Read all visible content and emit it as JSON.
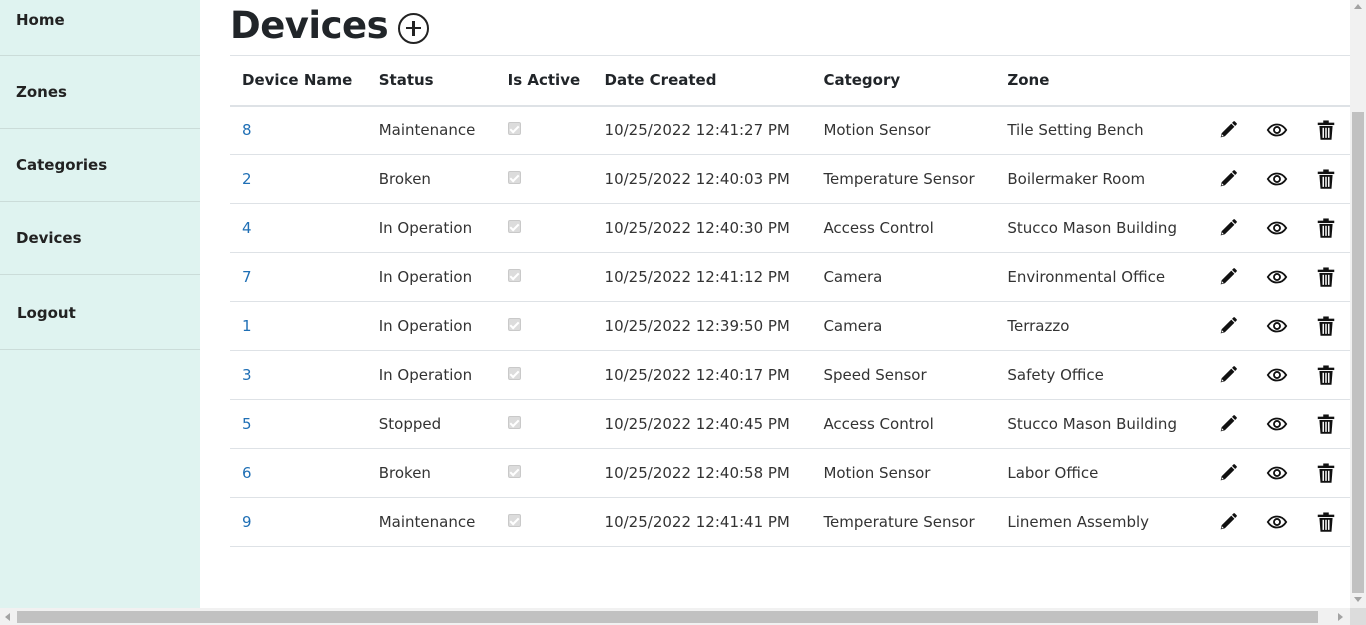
{
  "sidebar": {
    "items": [
      {
        "label": "Home"
      },
      {
        "label": "Zones"
      },
      {
        "label": "Categories"
      },
      {
        "label": "Devices"
      },
      {
        "label": "Logout"
      }
    ]
  },
  "page": {
    "title": "Devices",
    "add_icon": "plus-circle-icon"
  },
  "table": {
    "headers": [
      "Device Name",
      "Status",
      "Is Active",
      "Date Created",
      "Category",
      "Zone"
    ],
    "rows": [
      {
        "name": "8",
        "status": "Maintenance",
        "active": true,
        "date": "10/25/2022 12:41:27 PM",
        "category": "Motion Sensor",
        "zone": "Tile Setting Bench"
      },
      {
        "name": "2",
        "status": "Broken",
        "active": true,
        "date": "10/25/2022 12:40:03 PM",
        "category": "Temperature Sensor",
        "zone": "Boilermaker Room"
      },
      {
        "name": "4",
        "status": "In Operation",
        "active": true,
        "date": "10/25/2022 12:40:30 PM",
        "category": "Access Control",
        "zone": "Stucco Mason Building"
      },
      {
        "name": "7",
        "status": "In Operation",
        "active": true,
        "date": "10/25/2022 12:41:12 PM",
        "category": "Camera",
        "zone": "Environmental Office"
      },
      {
        "name": "1",
        "status": "In Operation",
        "active": true,
        "date": "10/25/2022 12:39:50 PM",
        "category": "Camera",
        "zone": "Terrazzo"
      },
      {
        "name": "3",
        "status": "In Operation",
        "active": true,
        "date": "10/25/2022 12:40:17 PM",
        "category": "Speed Sensor",
        "zone": "Safety Office"
      },
      {
        "name": "5",
        "status": "Stopped",
        "active": true,
        "date": "10/25/2022 12:40:45 PM",
        "category": "Access Control",
        "zone": "Stucco Mason Building"
      },
      {
        "name": "6",
        "status": "Broken",
        "active": true,
        "date": "10/25/2022 12:40:58 PM",
        "category": "Motion Sensor",
        "zone": "Labor Office"
      },
      {
        "name": "9",
        "status": "Maintenance",
        "active": true,
        "date": "10/25/2022 12:41:41 PM",
        "category": "Temperature Sensor",
        "zone": "Linemen Assembly"
      }
    ],
    "row_actions": [
      "pencil-icon",
      "eye-icon",
      "trash-icon"
    ]
  },
  "colors": {
    "sidebar_bg": "#dff3f0",
    "link": "#1f6fb5"
  }
}
